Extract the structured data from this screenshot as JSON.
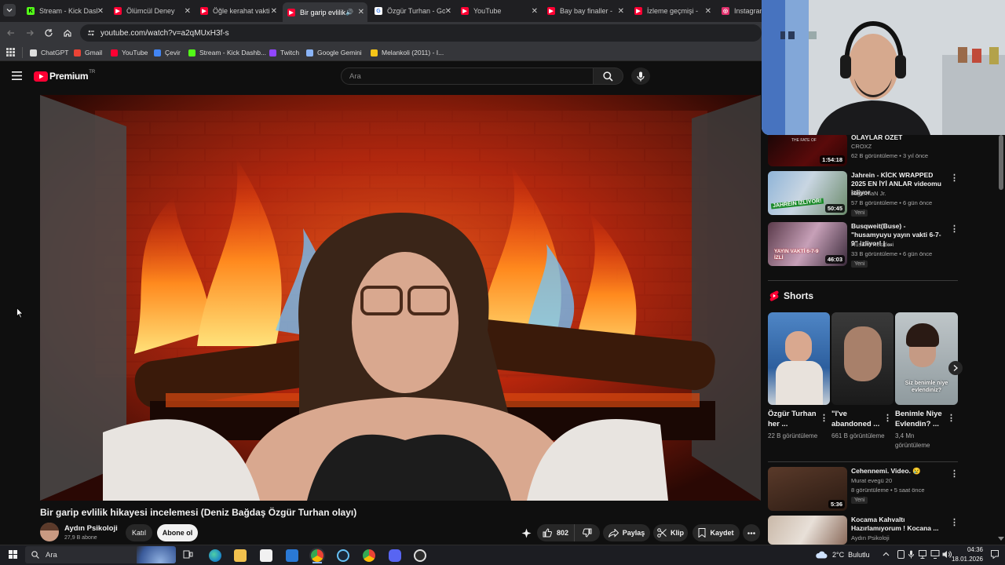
{
  "browser": {
    "tabs": [
      {
        "title": "Stream - Kick Dashb",
        "color": "#53fc18",
        "letter": "K"
      },
      {
        "title": "Ölümcül Deney",
        "color": "#ff0033",
        "letter": "▶"
      },
      {
        "title": "Öğle kerahat vakti",
        "color": "#ff0033",
        "letter": "▶"
      },
      {
        "title": "Bir garip evlilik",
        "color": "#ff0033",
        "letter": "▶"
      },
      {
        "title": "Özgür Turhan - Go",
        "color": "#ffffff",
        "letter": "G"
      },
      {
        "title": "YouTube",
        "color": "#ff0033",
        "letter": "▶"
      },
      {
        "title": "Bay bay finaller -",
        "color": "#ff0033",
        "letter": "▶"
      },
      {
        "title": "İzleme geçmişi -",
        "color": "#ff0033",
        "letter": "▶"
      },
      {
        "title": "Instagram",
        "color": "#e1306c",
        "letter": "◎"
      }
    ],
    "url": "youtube.com/watch?v=a2qMUxH3f-s",
    "bookmarks": [
      {
        "label": "ChatGPT",
        "color": "#dddddd"
      },
      {
        "label": "Gmail",
        "color": "#ea4335"
      },
      {
        "label": "YouTube",
        "color": "#ff0033"
      },
      {
        "label": "Çevir",
        "color": "#4285f4"
      },
      {
        "label": "Stream - Kick Dashb...",
        "color": "#53fc18"
      },
      {
        "label": "Twitch",
        "color": "#9146ff"
      },
      {
        "label": "Google Gemini",
        "color": "#8ab4f8"
      },
      {
        "label": "Melankoli (2011) - I...",
        "color": "#f5c518"
      }
    ]
  },
  "youtube": {
    "logo": "Premium",
    "logo_region": "TR",
    "search_placeholder": "Ara",
    "video_title": "Bir garip evlilik hikayesi incelemesi (Deniz Bağdaş Özgür Turhan olayı)",
    "channel_name": "Aydın Psikoloji",
    "subscribers": "27,9 B abone",
    "join_label": "Katıl",
    "subscribe_label": "Abone ol",
    "like_count": "802",
    "share_label": "Paylaş",
    "clip_label": "Klip",
    "save_label": "Kaydet"
  },
  "sidebar": {
    "partial_top": {
      "title": "OLAYLAR ÖZET",
      "channel": "CROXZ",
      "meta": "62 B görüntüleme • 3 yıl önce",
      "duration": "1:54:18"
    },
    "items": [
      {
        "title": "Jahrein - KİCK WRAPPED 2025 EN İYİ ANLAR videomu izliyor",
        "channel": "JagermaN Jr.",
        "meta": "57 B görüntüleme • 6 gün önce",
        "badge": "Yeni",
        "duration": "50:45",
        "thumb_text": "JAHREIN İZLİYOR!"
      },
      {
        "title": "Busqweit(Buse) - \"husamyuyu yayın vakti 6-7-9\" izliyor! | ...",
        "channel": "Husami Kesitleri",
        "meta": "33 B görüntüleme • 6 gün önce",
        "badge": "Yeni",
        "duration": "46:03",
        "thumb_text": "YAYIN VAKTİ 6-7-9 İZLİ"
      }
    ],
    "shorts_header": "Shorts",
    "shorts": [
      {
        "title": "Özgür Turhan her ...",
        "views": "22 B görüntüleme"
      },
      {
        "title": "\"I've abandoned ...",
        "views": "661 B görüntüleme"
      },
      {
        "title": "Benimle Niye Evlendin? ...",
        "views": "3,4 Mn görüntüleme",
        "overlay": "Siz benimle niye evlendiniz?"
      }
    ],
    "bottom_items": [
      {
        "title": "Cehennemi. Video. 😢",
        "channel": "Murat evegü 20",
        "meta": "8 görüntüleme • 5 saat önce",
        "badge": "Yeni",
        "duration": "5:36"
      },
      {
        "title": "Kocama Kahvaltı Hazırlamıyorum ! Kocana ...",
        "channel": "Aydın Psikoloji",
        "meta": "",
        "badge": "",
        "duration": ""
      }
    ]
  },
  "taskbar": {
    "search_label": "Ara",
    "weather": "2°C  Bulutlu",
    "time": "04:36",
    "date": "18.01.2026"
  },
  "colors": {
    "accent_red": "#ff0033",
    "bg": "#0f0f0f",
    "subscribe_bg": "#f1f1f1"
  }
}
